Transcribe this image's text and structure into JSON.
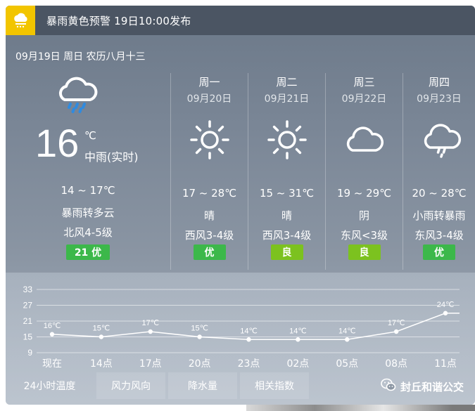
{
  "alert": {
    "text": "暴雨黄色预警 19日10:00发布",
    "icon": "rain-warning-icon",
    "color": "#f2c500"
  },
  "date_line": "09月19日 周日 农历八月十三",
  "today": {
    "icon": "rain-cloud-icon",
    "temp": "16",
    "unit": "℃",
    "condition_now": "中雨(实时)",
    "range": "14 ~ 17℃",
    "condition": "暴雨转多云",
    "wind": "北风4-5级",
    "aqi": "21 优",
    "aqi_color": "#3cb84a"
  },
  "forecast": [
    {
      "weekday": "周一",
      "date": "09月20日",
      "icon": "sun-icon",
      "range": "17 ~ 28℃",
      "condition": "晴",
      "wind": "西风3-4级",
      "aqi": "优",
      "aqi_color": "#3cb84a"
    },
    {
      "weekday": "周二",
      "date": "09月21日",
      "icon": "sun-icon",
      "range": "15 ~ 31℃",
      "condition": "晴",
      "wind": "西风3-4级",
      "aqi": "良",
      "aqi_color": "#7cc21f"
    },
    {
      "weekday": "周三",
      "date": "09月22日",
      "icon": "cloud-icon",
      "range": "19 ~ 29℃",
      "condition": "阴",
      "wind": "东风<3级",
      "aqi": "良",
      "aqi_color": "#7cc21f"
    },
    {
      "weekday": "周四",
      "date": "09月23日",
      "icon": "rain-cloud-icon",
      "range": "20 ~ 28℃",
      "condition": "小雨转暴雨",
      "wind": "东风3-4级",
      "aqi": "优",
      "aqi_color": "#3cb84a"
    }
  ],
  "chart_data": {
    "type": "line",
    "categories": [
      "现在",
      "14点",
      "17点",
      "20点",
      "23点",
      "02点",
      "05点",
      "08点",
      "11点"
    ],
    "values": [
      16,
      15,
      17,
      15,
      14,
      14,
      14,
      17,
      24
    ],
    "point_labels": [
      "16℃",
      "15℃",
      "17℃",
      "15℃",
      "14℃",
      "14℃",
      "14℃",
      "17℃",
      "24℃"
    ],
    "yticks": [
      33,
      27,
      21,
      15,
      9
    ],
    "ylim": [
      9,
      33
    ],
    "grid": true
  },
  "tabs": [
    {
      "label": "24小时温度",
      "active": true
    },
    {
      "label": "风力风向",
      "active": false
    },
    {
      "label": "降水量",
      "active": false
    },
    {
      "label": "相关指数",
      "active": false
    }
  ],
  "watermark": {
    "text": "封丘和谐公交",
    "icon": "wechat-icon"
  }
}
